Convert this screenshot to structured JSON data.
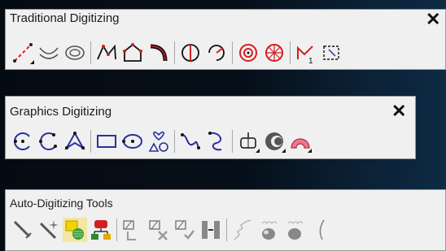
{
  "toolbars": {
    "traditional": {
      "title": "Traditional Digitizing",
      "close": "✕"
    },
    "graphics": {
      "title": "Graphics Digitizing",
      "close": "✕"
    },
    "auto": {
      "title": "Auto-Digitizing Tools"
    }
  },
  "colors": {
    "accent_red": "#d21e1e",
    "accent_blue": "#2b2f9e",
    "toolbar_bg": "#f0f0f0"
  },
  "icons": {
    "traditional": [
      "line-icon",
      "curve-icon",
      "spiral-icon",
      "open-polygon-icon",
      "closed-polygon-icon",
      "arc-icon",
      "circle-split-icon",
      "node-edit-icon",
      "radial-icon",
      "wheel-icon",
      "manual-icon",
      "lasso-icon"
    ],
    "graphics": [
      "circle-icon",
      "curve-circle-icon",
      "polygon-icon",
      "rectangle-icon",
      "ellipse-icon",
      "shapes-icon",
      "freehand-icon",
      "bezier-icon",
      "mirror-icon",
      "crescent-icon",
      "ring-icon"
    ],
    "auto": [
      "magic-wand-icon",
      "star-wand-icon",
      "fill-icon",
      "color-tree-icon",
      "trim-icon",
      "cut-icon",
      "check-icon",
      "align-icon",
      "zigzag-icon",
      "apple-icon",
      "apple2-icon",
      "curve-line-icon"
    ]
  }
}
